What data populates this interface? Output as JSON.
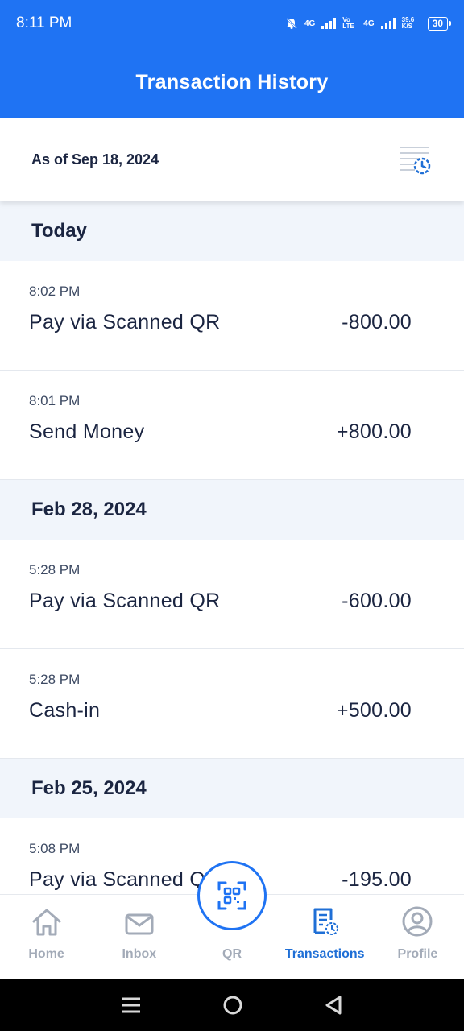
{
  "status_bar": {
    "time": "8:11 PM",
    "net1": "4G",
    "volte": "Vo LTE",
    "net2": "4G",
    "speed": "39.6 K/S",
    "battery": "30"
  },
  "header": {
    "title": "Transaction History"
  },
  "as_of": {
    "label": "As of Sep 18, 2024",
    "icon": "filter-history-icon"
  },
  "sections": [
    {
      "date": "Today",
      "transactions": [
        {
          "time": "8:02 PM",
          "description": "Pay via Scanned QR",
          "amount": "-800.00"
        },
        {
          "time": "8:01 PM",
          "description": "Send Money",
          "amount": "+800.00"
        }
      ]
    },
    {
      "date": "Feb 28, 2024",
      "transactions": [
        {
          "time": "5:28 PM",
          "description": "Pay via Scanned QR",
          "amount": "-600.00"
        },
        {
          "time": "5:28 PM",
          "description": "Cash-in",
          "amount": "+500.00"
        }
      ]
    },
    {
      "date": "Feb 25, 2024",
      "transactions": [
        {
          "time": "5:08 PM",
          "description": "Pay via Scanned QR",
          "amount": "-195.00"
        }
      ]
    }
  ],
  "bottom_nav": {
    "home": "Home",
    "inbox": "Inbox",
    "qr": "QR",
    "transactions": "Transactions",
    "profile": "Profile",
    "active": "transactions"
  },
  "colors": {
    "primary": "#1f73f3",
    "active_nav": "#1f6fd6",
    "inactive_nav": "#a3abb8",
    "section_bg": "#f1f5fb",
    "text": "#1b2541"
  }
}
